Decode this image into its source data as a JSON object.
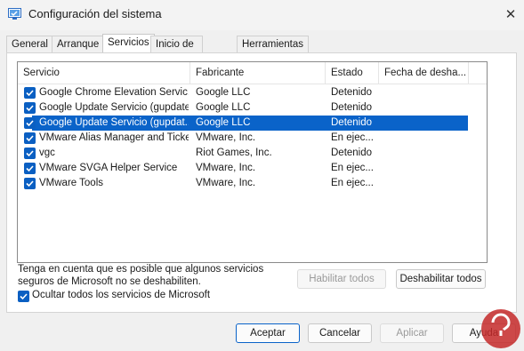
{
  "window": {
    "title": "Configuración del sistema",
    "close_glyph": "✕"
  },
  "tabs": [
    {
      "label": "General"
    },
    {
      "label": "Arranque"
    },
    {
      "label": "Servicios"
    },
    {
      "label": "Inicio de Windows"
    },
    {
      "label": "Herramientas"
    }
  ],
  "services": {
    "columns": [
      "Servicio",
      "Fabricante",
      "Estado",
      "Fecha de desha..."
    ],
    "rows": [
      {
        "name": "Google Chrome Elevation Servic...",
        "vendor": "Google LLC",
        "status": "Detenido",
        "checked": true,
        "selected": false
      },
      {
        "name": "Google Update Servicio (gupdate)",
        "vendor": "Google LLC",
        "status": "Detenido",
        "checked": true,
        "selected": false
      },
      {
        "name": "Google Update Servicio (gupdat...",
        "vendor": "Google LLC",
        "status": "Detenido",
        "checked": true,
        "selected": true
      },
      {
        "name": "VMware Alias Manager and Ticke...",
        "vendor": "VMware, Inc.",
        "status": "En ejec...",
        "checked": true,
        "selected": false
      },
      {
        "name": "vgc",
        "vendor": "Riot Games, Inc.",
        "status": "Detenido",
        "checked": true,
        "selected": false
      },
      {
        "name": "VMware SVGA Helper Service",
        "vendor": "VMware, Inc.",
        "status": "En ejec...",
        "checked": true,
        "selected": false
      },
      {
        "name": "VMware Tools",
        "vendor": "VMware, Inc.",
        "status": "En ejec...",
        "checked": true,
        "selected": false
      }
    ]
  },
  "note": {
    "line1": "Tenga en cuenta que es posible que algunos servicios",
    "line2": "seguros de Microsoft no se deshabiliten."
  },
  "buttons": {
    "enable_all": "Habilitar todos",
    "disable_all": "Deshabilitar todos",
    "ok": "Aceptar",
    "cancel": "Cancelar",
    "apply": "Aplicar",
    "help": "Ayuda"
  },
  "hide_microsoft": {
    "label": "Ocultar todos los servicios de Microsoft",
    "checked": true
  },
  "colors": {
    "selection": "#0a63c9",
    "checkbox": "#0a5fc2"
  }
}
